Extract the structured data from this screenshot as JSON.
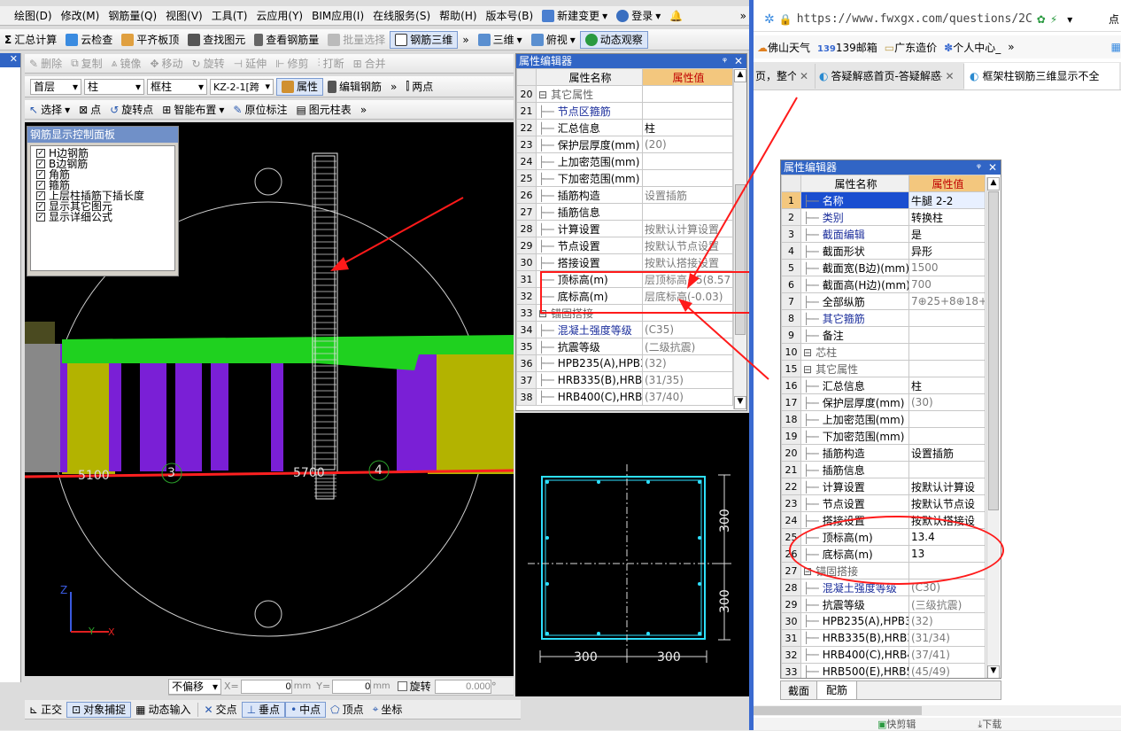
{
  "menu": [
    "绘图(D)",
    "修改(M)",
    "钢筋量(Q)",
    "视图(V)",
    "工具(T)",
    "云应用(Y)",
    "BIM应用(I)",
    "在线服务(S)",
    "帮助(H)",
    "版本号(B)",
    "新建变更",
    "登录"
  ],
  "toolbar1": [
    "汇总计算",
    "云检查",
    "平齐板顶",
    "查找图元",
    "查看钢筋量",
    "批量选择",
    "钢筋三维",
    "三维",
    "俯视",
    "动态观察"
  ],
  "toolbar2": [
    "删除",
    "复制",
    "镜像",
    "移动",
    "旋转",
    "延伸",
    "修剪",
    "打断",
    "合并"
  ],
  "toolbar3": {
    "floor": "首层",
    "cat": "柱",
    "type": "框柱",
    "item": "KZ-2-1[跨",
    "prop": "属性",
    "edit": "编辑钢筋",
    "twopoint": "两点"
  },
  "toolbar4": [
    "选择",
    "点",
    "旋转点",
    "智能布置",
    "原位标注",
    "图元柱表"
  ],
  "rebar_panel": {
    "title": "钢筋显示控制面板",
    "items": [
      "H边钢筋",
      "B边钢筋",
      "角筋",
      "箍筋",
      "上层柱插筋下插长度",
      "显示其它图元",
      "显示详细公式"
    ]
  },
  "viewport_labels": {
    "l1": "3",
    "l2": "5700",
    "l3": "4",
    "l4": "5100",
    "axis_z": "Z",
    "axis_y": "Y",
    "axis_x": "X"
  },
  "editor_left": {
    "title": "属性编辑器",
    "pin": "ᵠ",
    "close": "✕",
    "head_name": "属性名称",
    "head_val": "属性值",
    "rows": [
      {
        "n": "20",
        "k": "其它属性",
        "v": "",
        "group": true
      },
      {
        "n": "21",
        "k": "节点区箍筋",
        "v": "",
        "blue": true
      },
      {
        "n": "22",
        "k": "汇总信息",
        "v": "柱"
      },
      {
        "n": "23",
        "k": "保护层厚度(mm)",
        "v": "(20)"
      },
      {
        "n": "24",
        "k": "上加密范围(mm)",
        "v": ""
      },
      {
        "n": "25",
        "k": "下加密范围(mm)",
        "v": ""
      },
      {
        "n": "26",
        "k": "插筋构造",
        "v": "设置插筋"
      },
      {
        "n": "27",
        "k": "插筋信息",
        "v": ""
      },
      {
        "n": "28",
        "k": "计算设置",
        "v": "按默认计算设置"
      },
      {
        "n": "29",
        "k": "节点设置",
        "v": "按默认节点设置"
      },
      {
        "n": "30",
        "k": "搭接设置",
        "v": "按默认搭接设置"
      },
      {
        "n": "31",
        "k": "顶标高(m)",
        "v": "层顶标高+5(8.57"
      },
      {
        "n": "32",
        "k": "底标高(m)",
        "v": "层底标高(-0.03)"
      },
      {
        "n": "33",
        "k": "锚固搭接",
        "v": "",
        "group": true
      },
      {
        "n": "34",
        "k": "混凝土强度等级",
        "v": "(C35)",
        "blue": true
      },
      {
        "n": "35",
        "k": "抗震等级",
        "v": "(二级抗震)"
      },
      {
        "n": "36",
        "k": "HPB235(A),HPB3",
        "v": "(32)"
      },
      {
        "n": "37",
        "k": "HRB335(B),HRB3",
        "v": "(31/35)"
      },
      {
        "n": "38",
        "k": "HRB400(C),HRB4",
        "v": "(37/40)"
      }
    ]
  },
  "section": {
    "dim_h1": "300",
    "dim_h2": "300",
    "dim_v1": "300",
    "dim_v2": "300"
  },
  "statusbar": {
    "offset": "不偏移",
    "xlabel": "X=",
    "x": "0",
    "ylabel": "Y=",
    "y": "0",
    "unit": "mm",
    "rotate": "旋转",
    "angle": "0.000",
    "deg": "°"
  },
  "snapbar": [
    "正交",
    "对象捕捉",
    "动态输入",
    "交点",
    "垂点",
    "中点",
    "顶点",
    "坐标"
  ],
  "browser": {
    "url": "https://www.fwxgx.com/questions/2C",
    "bookmarks": [
      "佛山天气",
      "139邮箱",
      "广东造价",
      "个人中心_"
    ],
    "tabs": [
      "页，整个",
      "答疑解惑首页-答疑解惑-",
      "框架柱钢筋三维显示不全"
    ],
    "edge_char": "点"
  },
  "editor_right": {
    "title": "属性编辑器",
    "pin": "ᵠ",
    "close": "✕",
    "head_name": "属性名称",
    "head_val": "属性值",
    "rows": [
      {
        "n": "1",
        "k": "名称",
        "v": "牛腿 2-2",
        "blue": true,
        "sel": true
      },
      {
        "n": "2",
        "k": "类别",
        "v": "转换柱",
        "blue": true
      },
      {
        "n": "3",
        "k": "截面编辑",
        "v": "是",
        "blue": true
      },
      {
        "n": "4",
        "k": "截面形状",
        "v": "异形"
      },
      {
        "n": "5",
        "k": "截面宽(B边)(mm)",
        "v": "1500",
        "gray": true
      },
      {
        "n": "6",
        "k": "截面高(H边)(mm)",
        "v": "700",
        "gray": true
      },
      {
        "n": "7",
        "k": "全部纵筋",
        "v": "7⊕25+8⊕18+1",
        "gray": true
      },
      {
        "n": "8",
        "k": "其它箍筋",
        "v": "",
        "blue": true
      },
      {
        "n": "9",
        "k": "备注",
        "v": ""
      },
      {
        "n": "10",
        "k": "芯柱",
        "v": "",
        "group": true
      },
      {
        "n": "15",
        "k": "其它属性",
        "v": "",
        "group": true
      },
      {
        "n": "16",
        "k": "汇总信息",
        "v": "柱"
      },
      {
        "n": "17",
        "k": "保护层厚度(mm)",
        "v": "(30)"
      },
      {
        "n": "18",
        "k": "上加密范围(mm)",
        "v": ""
      },
      {
        "n": "19",
        "k": "下加密范围(mm)",
        "v": ""
      },
      {
        "n": "20",
        "k": "插筋构造",
        "v": "设置插筋"
      },
      {
        "n": "21",
        "k": "插筋信息",
        "v": ""
      },
      {
        "n": "22",
        "k": "计算设置",
        "v": "按默认计算设"
      },
      {
        "n": "23",
        "k": "节点设置",
        "v": "按默认节点设"
      },
      {
        "n": "24",
        "k": "搭接设置",
        "v": "按默认搭接设"
      },
      {
        "n": "25",
        "k": "顶标高(m)",
        "v": "13.4"
      },
      {
        "n": "26",
        "k": "底标高(m)",
        "v": "13"
      },
      {
        "n": "27",
        "k": "锚固搭接",
        "v": "",
        "group": true
      },
      {
        "n": "28",
        "k": "混凝土强度等级",
        "v": "(C30)",
        "blue": true
      },
      {
        "n": "29",
        "k": "抗震等级",
        "v": "(三级抗震)"
      },
      {
        "n": "30",
        "k": "HPB235(A),HPB3",
        "v": "(32)"
      },
      {
        "n": "31",
        "k": "HRB335(B),HRB3",
        "v": "(31/34)"
      },
      {
        "n": "32",
        "k": "HRB400(C),HRB4",
        "v": "(37/41)"
      },
      {
        "n": "33",
        "k": "HRB500(E),HRB5",
        "v": "(45/49)"
      }
    ],
    "tabs": [
      "截面",
      "配筋"
    ]
  },
  "taskbar": {
    "t1": "快剪辑",
    "t2": "下载"
  },
  "colors": {
    "annotation": "#e00000",
    "title_blue": "#3165c5",
    "header_orange": "#f3c77e",
    "beam_green": "#1fd11f",
    "column_purple": "#7a1fd6",
    "wall_olive": "#b0b000",
    "section_cyan": "#2ee0ff"
  }
}
